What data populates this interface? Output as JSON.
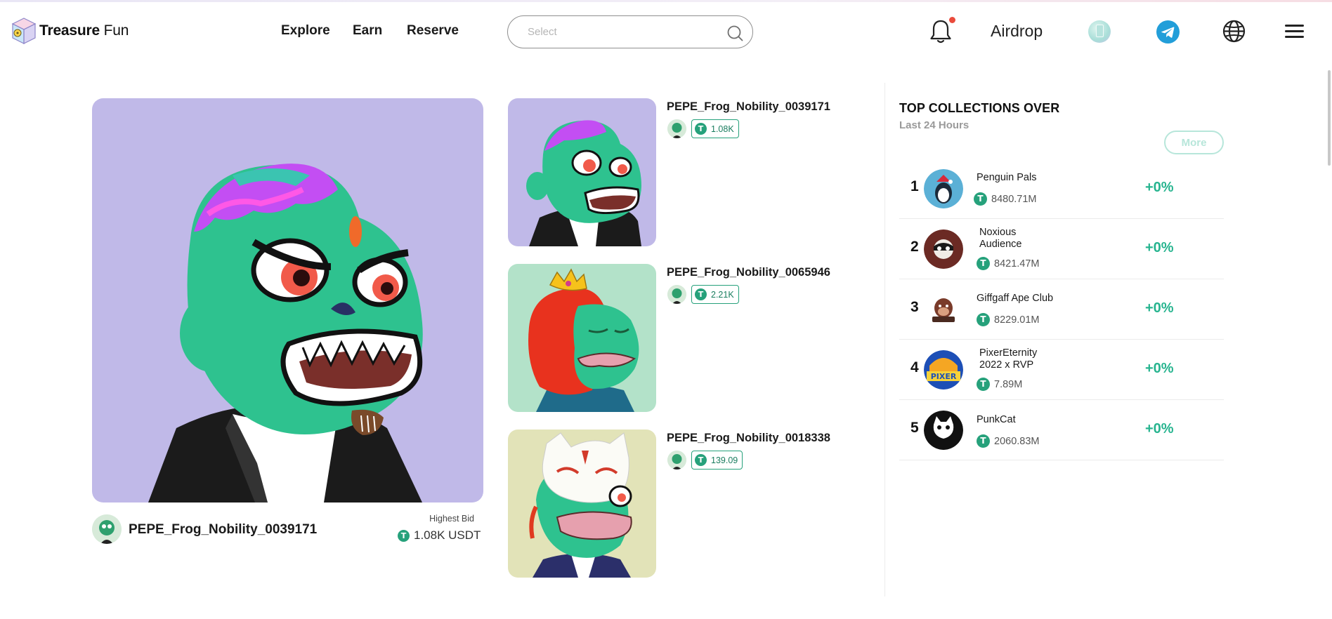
{
  "brand": {
    "name_bold": "Treasure",
    "name_light": "Fun"
  },
  "nav": {
    "explore": "Explore",
    "earn": "Earn",
    "reserve": "Reserve"
  },
  "search": {
    "placeholder": "Select",
    "value": ""
  },
  "header": {
    "airdrop": "Airdrop"
  },
  "featured": {
    "name": "PEPE_Frog_Nobility_0039171",
    "highest_bid_label": "Highest Bid",
    "highest_bid_value": "1.08K USDT"
  },
  "cards": [
    {
      "title": "PEPE_Frog_Nobility_0039171",
      "bid": "1.08K"
    },
    {
      "title": "PEPE_Frog_Nobility_0065946",
      "bid": "2.21K"
    },
    {
      "title": "PEPE_Frog_Nobility_0018338",
      "bid": "139.09"
    }
  ],
  "top_collections": {
    "title": "TOP COLLECTIONS OVER",
    "subtitle": "Last 24 Hours",
    "more_label": "More",
    "rows": [
      {
        "rank": "1",
        "name": "Penguin Pals",
        "volume": "8480.71M",
        "change": "+0%"
      },
      {
        "rank": "2",
        "name": "Noxious Audience",
        "volume": "8421.47M",
        "change": "+0%"
      },
      {
        "rank": "3",
        "name": "Giffgaff Ape Club",
        "volume": "8229.01M",
        "change": "+0%"
      },
      {
        "rank": "4",
        "name": "PixerEternity 2022 x RVP",
        "volume": "7.89M",
        "change": "+0%"
      },
      {
        "rank": "5",
        "name": "PunkCat",
        "volume": "2060.83M",
        "change": "+0%"
      }
    ]
  },
  "colors": {
    "accent_green": "#27b48f",
    "tether_green": "#26a17b",
    "featured_bg": "#c0b9e8",
    "telegram_blue": "#229ed9"
  }
}
